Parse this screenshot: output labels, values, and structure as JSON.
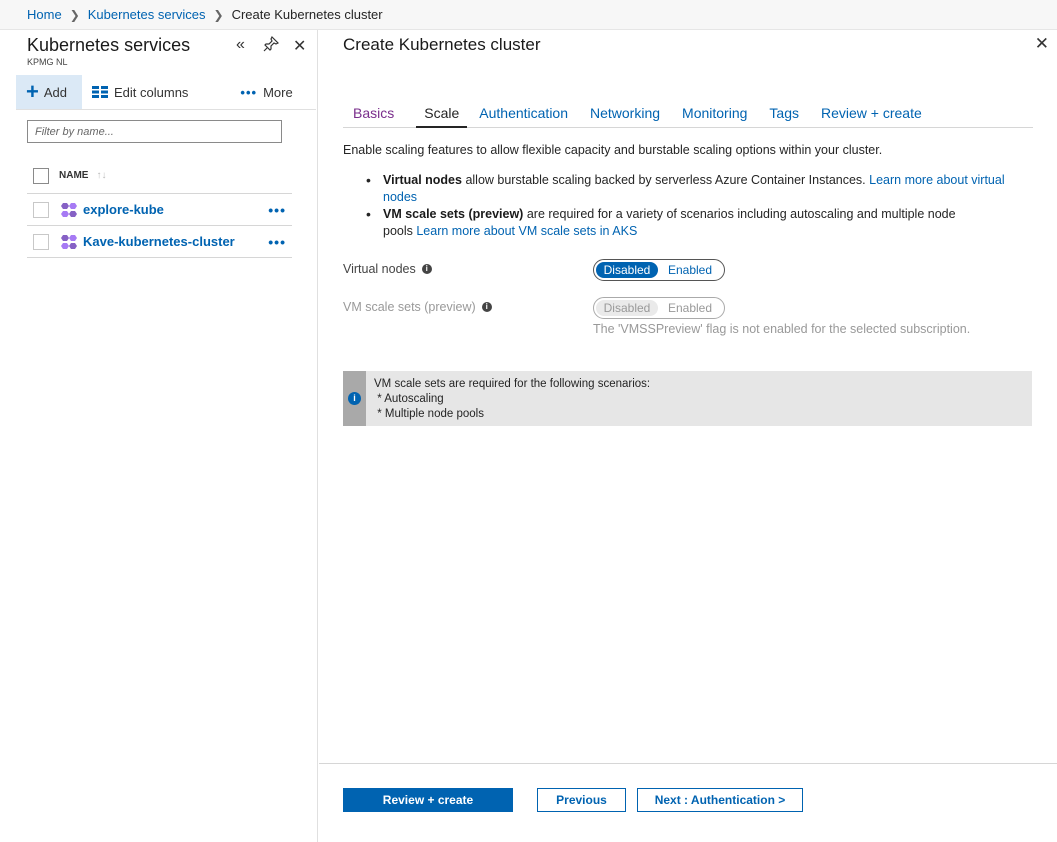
{
  "breadcrumb": {
    "home": "Home",
    "services": "Kubernetes services",
    "current": "Create Kubernetes cluster"
  },
  "left": {
    "title": "Kubernetes services",
    "subtitle": "KPMG NL",
    "toolbar": {
      "add": "Add",
      "edit_columns": "Edit columns",
      "more": "More"
    },
    "filter_placeholder": "Filter by name...",
    "column_name": "NAME",
    "rows": [
      {
        "name": "explore-kube"
      },
      {
        "name": "Kave-kubernetes-cluster"
      }
    ]
  },
  "right": {
    "title": "Create Kubernetes cluster",
    "tabs": [
      "Basics",
      "Scale",
      "Authentication",
      "Networking",
      "Monitoring",
      "Tags",
      "Review + create"
    ],
    "active_tab": "Scale",
    "intro": "Enable scaling features to allow flexible capacity and burstable scaling options within your cluster.",
    "bullets": {
      "vn_bold": "Virtual nodes",
      "vn_text": " allow burstable scaling backed by serverless Azure Container Instances. ",
      "vn_link1": "Learn more about virtual",
      "vn_link2": "nodes",
      "vmss_bold": "VM scale sets (preview)",
      "vmss_text": " are required for a variety of scenarios including autoscaling and multiple node",
      "vmss_text2": "pools ",
      "vmss_link": "Learn more about VM scale sets in AKS"
    },
    "virtual_nodes": {
      "label": "Virtual nodes",
      "disabled": "Disabled",
      "enabled": "Enabled",
      "selected": "Disabled"
    },
    "vmss": {
      "label": "VM scale sets (preview)",
      "disabled": "Disabled",
      "enabled": "Enabled",
      "selected": "Disabled",
      "note": "The 'VMSSPreview' flag is not enabled for the selected subscription."
    },
    "info_box": {
      "line1": "VM scale sets are required for the following scenarios:",
      "line2": " * Autoscaling",
      "line3": " * Multiple node pools"
    },
    "buttons": {
      "review_create": "Review + create",
      "previous": "Previous",
      "next": "Next : Authentication >"
    }
  },
  "colors": {
    "accent": "#0063b1",
    "visited_tab": "#7a2e8c",
    "info_bg": "#e6e6e6"
  }
}
